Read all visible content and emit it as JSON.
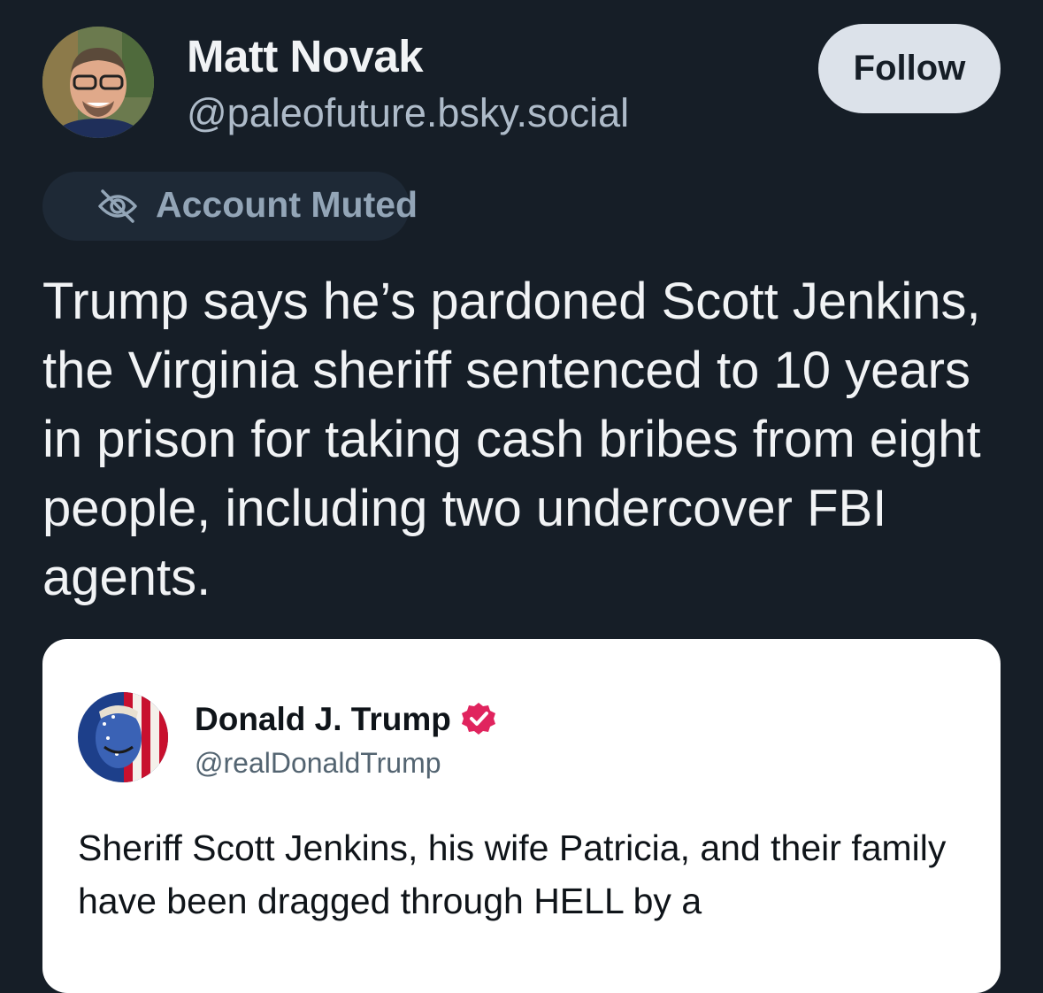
{
  "author": {
    "display_name": "Matt Novak",
    "handle": "@paleofuture.bsky.social"
  },
  "follow_label": "Follow",
  "muted_badge": {
    "icon": "eye-slash-icon",
    "label": "Account Muted"
  },
  "post": {
    "text": "Trump says he’s pardoned Scott Jenkins, the Virginia sheriff sentenced to 10 years in prison for taking cash bribes from eight people, including two undercover FBI agents."
  },
  "embed": {
    "display_name": "Donald J. Trump",
    "verified_icon": "verified-badge-icon",
    "handle": "@realDonaldTrump",
    "text": "Sheriff Scott Jenkins, his wife Patricia, and their family have been dragged through HELL by a"
  },
  "colors": {
    "background": "#161e27",
    "primary_text": "#f1f3f5",
    "secondary_text": "#aebbc9",
    "follow_button_bg": "#dce2ea",
    "muted_pill_bg": "#1e2936",
    "muted_text": "#93a5b7",
    "verified_badge": "#e0245e"
  }
}
